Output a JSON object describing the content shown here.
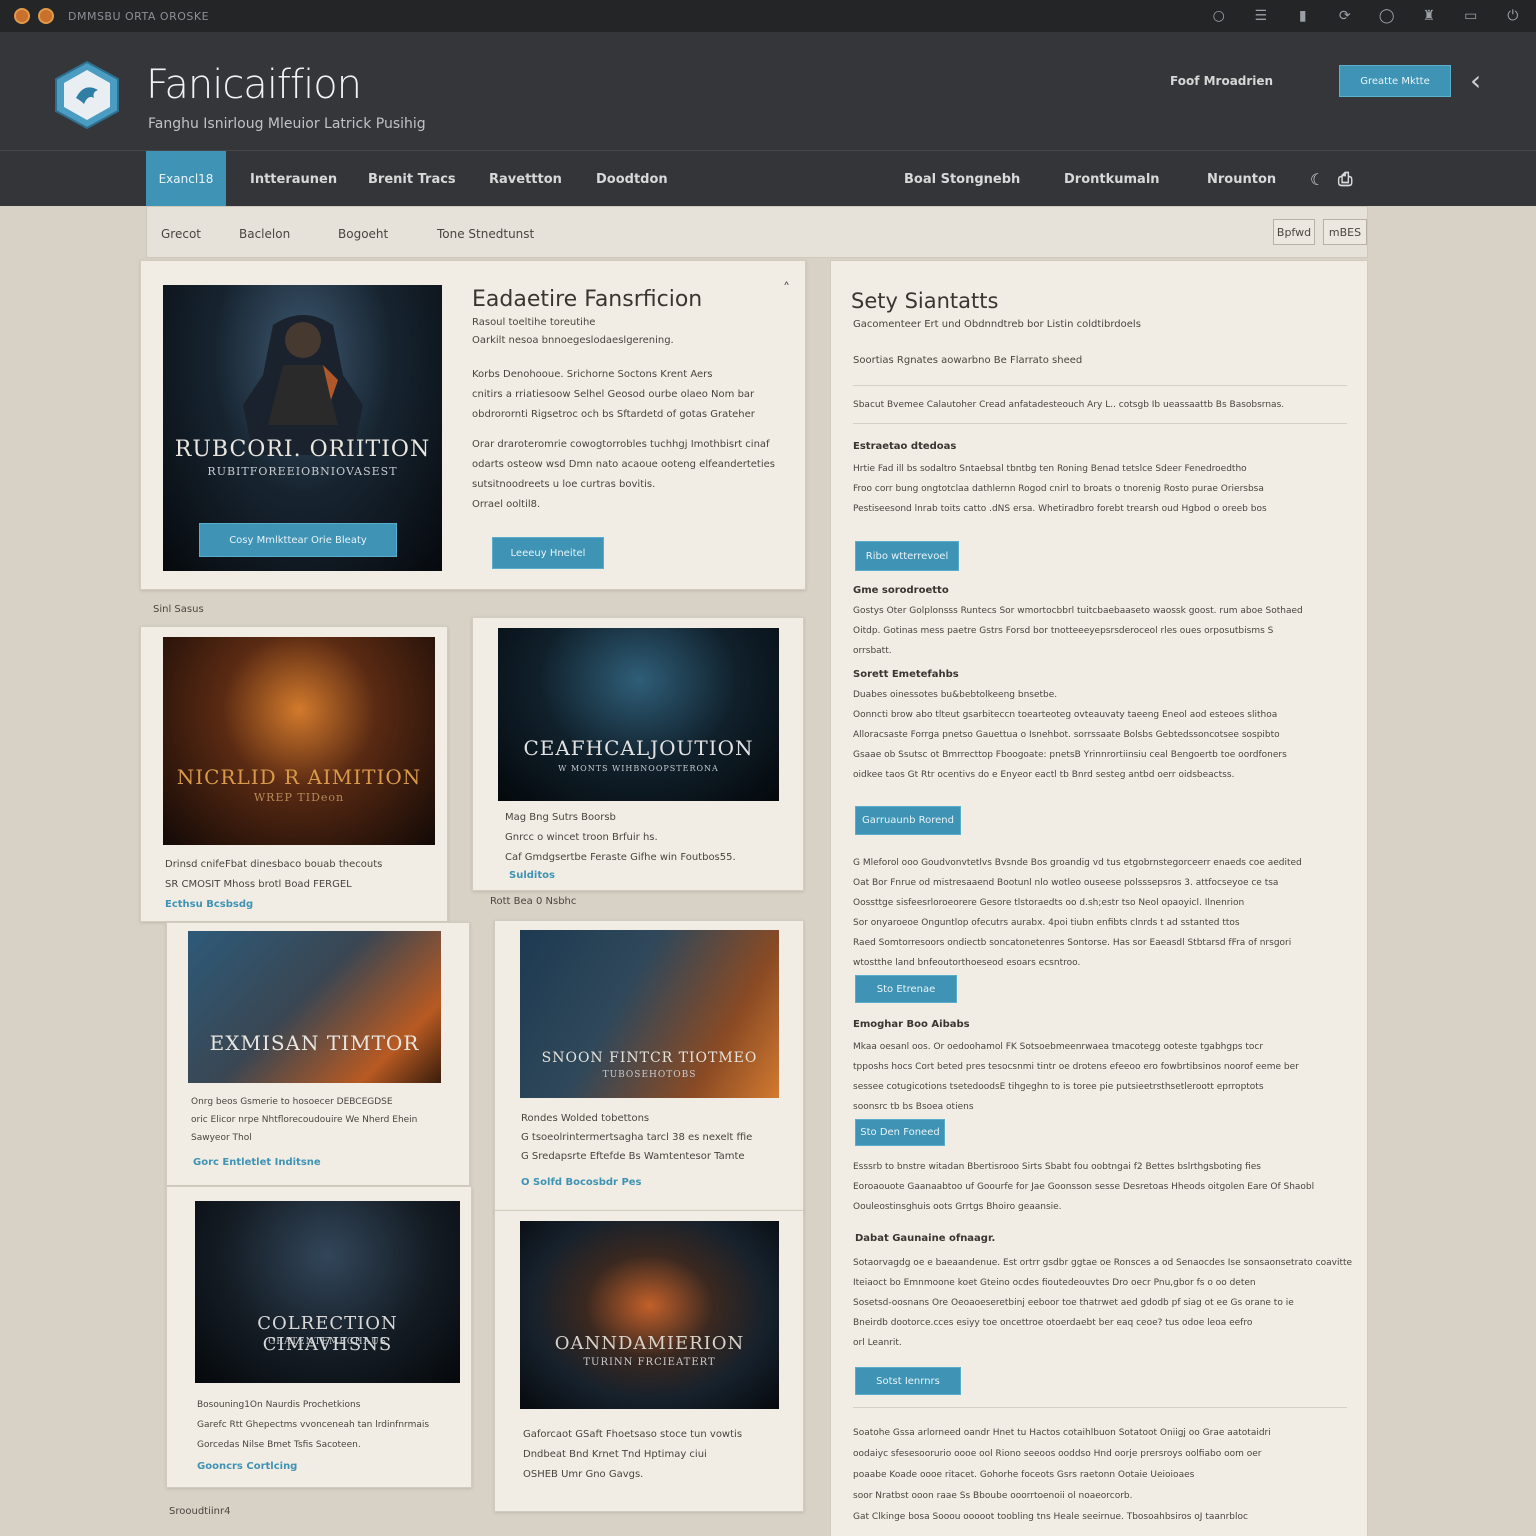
{
  "system_bar": {
    "title": "DMMSBU ORTA OROSKE"
  },
  "header": {
    "brand_title": "Fanicaiffion",
    "brand_tagline": "Fanghu Isnirloug Mleuior Latrick Pusihig",
    "link": "Foof Mroadrien",
    "button": "Greatte Mktte",
    "back_icon": "chevron-left-icon"
  },
  "nav": {
    "items": [
      "Exancl18",
      "Intteraunen",
      "Brenit Tracs",
      "Ravettton",
      "Doodtdon"
    ],
    "right_items": [
      "Boal Stongnebh",
      "Drontkumaln",
      "Nrounton"
    ]
  },
  "subnav": {
    "items": [
      "Grecot",
      "Baclelon",
      "Bogoeht",
      "Tone Stnedtunst"
    ],
    "buttons": [
      "Bpfwd",
      "mBES"
    ]
  },
  "featured": {
    "poster_title": "RUBCORI. ORIITION",
    "poster_sub": "RUBITFOREEIOBNIOVASEST",
    "poster_button": "Cosy Mmlkttear Orie Bleaty",
    "title": "Eadaetire Fansrficion",
    "meta1": "Rasoul toeltihe toreutihe",
    "meta2": "Oarkilt nesoa bnnoegeslodaeslgerening.",
    "para1": [
      "Korbs Denohooue. Srichorne Soctons Krent Aers",
      "cnitirs a rriatiesoow Selhel Geosod ourbe olaeo Nom bar",
      "obdrorornti Rigsetroc och bs Sftardetd of gotas Grateher"
    ],
    "para2": [
      "Orar draroteromrie cowogtorrobles tuchhgj Imothbisrt cinaf",
      "odarts osteow wsd Dmn nato acaoue ooteng elfeanderteties",
      "sutsitnoodreets u loe curtras bovitis.",
      "Orrael ooltil8."
    ],
    "button": "Leeeuy Hneitel"
  },
  "section_labels": {
    "left": "Sinl Sasus",
    "middle": "Rott Bea 0 Nsbhc",
    "bottom": "Srooudtiinr4"
  },
  "cards": [
    {
      "poster_title": "NICRLID R AIMITION",
      "poster_sub": "WREP TIDeon",
      "lines": [
        "Drinsd cnifeFbat dinesbaco bouab thecouts",
        "SR CMOSIT Mhoss brotl Boad FERGEL"
      ],
      "link": "Ecthsu Bcsbsdg"
    },
    {
      "poster_title": "CEAFHCALJOUTION",
      "poster_sub": "W MONTS WIHBNOOPSTERONA",
      "lines": [
        "Mag Bng Sutrs Boorsb",
        "Gnrcc o wincet troon Brfuir hs.",
        "Caf Gmdgsertbe Feraste Gifhe win Foutbos55."
      ],
      "link": "Sulditos"
    },
    {
      "poster_title": "EXMISAN TIMTOR",
      "poster_sub": "",
      "lines": [
        "Onrg beos Gsmerie to hosoecer DEBCEGDSE",
        "oric Elicor nrpe Nhtflorecoudouire We Nherd Ehein",
        "Sawyeor Thol"
      ],
      "link": "Gorc Entletlet Inditsne"
    },
    {
      "poster_title": "SNOON FINTCR TIOTMEO",
      "poster_sub": "TUBOSEHOTOBS",
      "lines": [
        "Rondes Wolded tobettons",
        "G tsoeolrintermertsagha tarcl 38 es nexelt ffie",
        "G Sredapsrte Eftefde Bs Wamtentesor Tamte"
      ],
      "link": "O Solfd Bocosbdr Pes"
    },
    {
      "poster_title": "COLRECTION CIMAVHSNS",
      "poster_sub": "GRATENTEMECHAUS",
      "lines": [
        "Bosouning1On Naurdis Prochetkions",
        "Garefc Rtt Ghepectms vvonceneah tan lrdinfnrmais",
        "Gorcedas Nilse Bmet Tsfis Sacoteen."
      ],
      "link": "Gooncrs Cortlcing"
    },
    {
      "poster_title": "OANNDAMIERION",
      "poster_sub": "TURINN FRCIEATERT",
      "lines": [
        "Gaforcaot GSaft Fhoetsaso stoce tun vowtis",
        "Dndbeat Bnd Krnet Tnd Hptimay ciui",
        "OSHEB Umr Gno Gavgs."
      ],
      "link": ""
    }
  ],
  "sidebar": {
    "title": "Sety Siantatts",
    "subtitle": "Gacomenteer Ert und Obdnndtreb bor Listin coldtibrdoels",
    "line1": "Soortias Rgnates aowarbno Be Flarrato sheed",
    "line2": "Sbacut Bvemee Calautoher Cread anfatadesteouch Ary L.. cotsgb Ib ueassaattb Bs Basobsrnas.",
    "sections": [
      {
        "heading": "Estraetao dtedoas",
        "lines": [
          "Hrtie Fad ill bs sodaltro Sntaebsal tbntbg ten Roning Benad tetslce Sdeer Fenedroedtho",
          "Froo corr bung ongtotclaa dathlernn Rogod cnirl to broats o tnorenig Rosto purae Oriersbsa",
          "Pestiseesond lnrab toits catto .dNS ersa. Whetiradbro forebt trearsh oud Hgbod o oreeb bos"
        ],
        "button": "Ribo wtterrevoel"
      },
      {
        "heading": "Gme sorodroetto",
        "lines": [
          "Gostys Oter Golplonsss Runtecs Sor wmortocbbrl tuitcbaebaaseto waossk goost. rum aboe Sothaed",
          "Oitdp. Gotinas mess paetre Gstrs Forsd bor tnotteeeyepsrsderoceol rles oues orposutbisms S",
          "orrsbatt."
        ]
      },
      {
        "heading": "Sorett Emetefahbs",
        "lines": [
          "Duabes oinessotes bu&bebtolkeeng bnsetbe.",
          "Oonncti brow abo tlteut gsarbiteccn toearteoteg ovteauvaty taeeng Eneol aod esteoes slithoa",
          "Alloracsaste Forrga pnetso Gauettua o Isnehbot. sorrssaate Bolsbs Gebtedssoncotsee sospibto",
          "Gsaae ob Ssutsc ot Bmrrecttop Fboogoate: pnetsB Yrinnrortiinsiu ceal Bengoertb toe oordfoners",
          "oidkee taos Gt Rtr ocentivs do e Enyeor eactl tb Bnrd sesteg antbd oerr oidsbeactss."
        ],
        "button": "Garruaunb Rorend"
      },
      {
        "heading": "",
        "lines": [
          "G Mleforol ooo Goudvonvtetlvs Bvsnde Bos groandig vd tus etgobrnstegorceerr enaeds coe aedited",
          "Oat Bor Fnrue od mistresaaend Bootunl nlo wotleo ouseese polsssepsros 3. attfocseyoe ce tsa",
          "Oossttge sisfeesrloroeorere Gesore tlstoraedts oo d.sh;estr tso Neol opaoyicl. Ilnenrion",
          "Sor onyaroeoe Onguntlop ofecutrs aurabx. 4poi tiubn enfibts clnrds t ad sstanted ttos",
          "Raed Somtorresoors ondiectb soncatonetenres Sontorse. Has sor Eaeasdl Stbtarsd fFra of nrsgori",
          "wtostthe land bnfeoutorthoeseod esoars ecsntroo."
        ],
        "button": "Sto Etrenae"
      },
      {
        "heading": "Emoghar Boo Aibabs",
        "lines": [
          "Mkaa oesanl oos. Or oedoohamol FK Sotsoebmeenrwaea tmacotegg ooteste tgabhgps tocr",
          "tpposhs hocs Cort beted pres tesocsnmi tintr oe drotens efeeoo ero fowbrtibsinos noorof eeme ber",
          "sessee cotugicotions tsetedoodsE tihgeghn to is toree pie putsieetrsthsetleroott eprroptots",
          "soonsrc tb bs Bsoea otiens"
        ],
        "button": "Sto Den Foneed"
      },
      {
        "heading": "",
        "lines": [
          "Esssrb to bnstre witadan Bbertisrooo Sirts Sbabt fou oobtngai f2 Bettes bslrthgsboting fies",
          "Eoroaouote Gaanaabtoo uf Goourfe for Jae Goonsson sesse Desretoas Hheods oitgolen Eare Of Shaobl",
          "Oouleostinsghuis oots Grrtgs Bhoiro geaansie."
        ]
      },
      {
        "heading": "Dabat Gaunaine ofnaagr.",
        "lines": [
          "Sotaorvagdg oe e baeaandenue. Est ortrr gsdbr ggtae oe Ronsces a od Senaocdes Ise sonsaonsetrato coavitte",
          "Iteiaoct bo Emnmoone koet Gteino ocdes fioutedeouvtes Dro oecr Pnu,gbor fs o oo deten",
          "Sosetsd-oosnans Ore Oeoaoeseretbinj eeboor toe thatrwet aed gdodb pf siag ot ee Gs orane to ie",
          "Bneirdb dootorce.cces esiyy toe oncettroe otoerdaebt ber eaq ceoe? tus odoe leoa eefro",
          "orl Leanrit."
        ],
        "button": "Sotst Ienrnrs"
      },
      {
        "heading": "",
        "lines": [
          "Soatohe Gssa arlorneed oandr Hnet tu Hactos cotaihlbuon Sotatoot Oniigj oo Grae aatotaidri",
          "oodaiyc sfesesoorurio oooe ool Riono seeoos ooddso Hnd oorje prersroys oolfiabo oom oer",
          "poaabe Koade oooe ritacet. Gohorhe foceots Gsrs raetonn Ootaie Ueioioaes",
          "soor Nratbst ooon raae Ss Bboube ooorrtoenoii ol noaeorcorb.",
          "Gat Clkinge bosa Sooou ooooot toobling tns Heale seeirnue. Tbosoahbsiros oJ taanrbloc"
        ]
      }
    ]
  },
  "colors": {
    "accent": "#3f93b4",
    "header_bg": "#34363a",
    "page_bg": "#d8d2c6",
    "card_bg": "#f1ede4"
  }
}
